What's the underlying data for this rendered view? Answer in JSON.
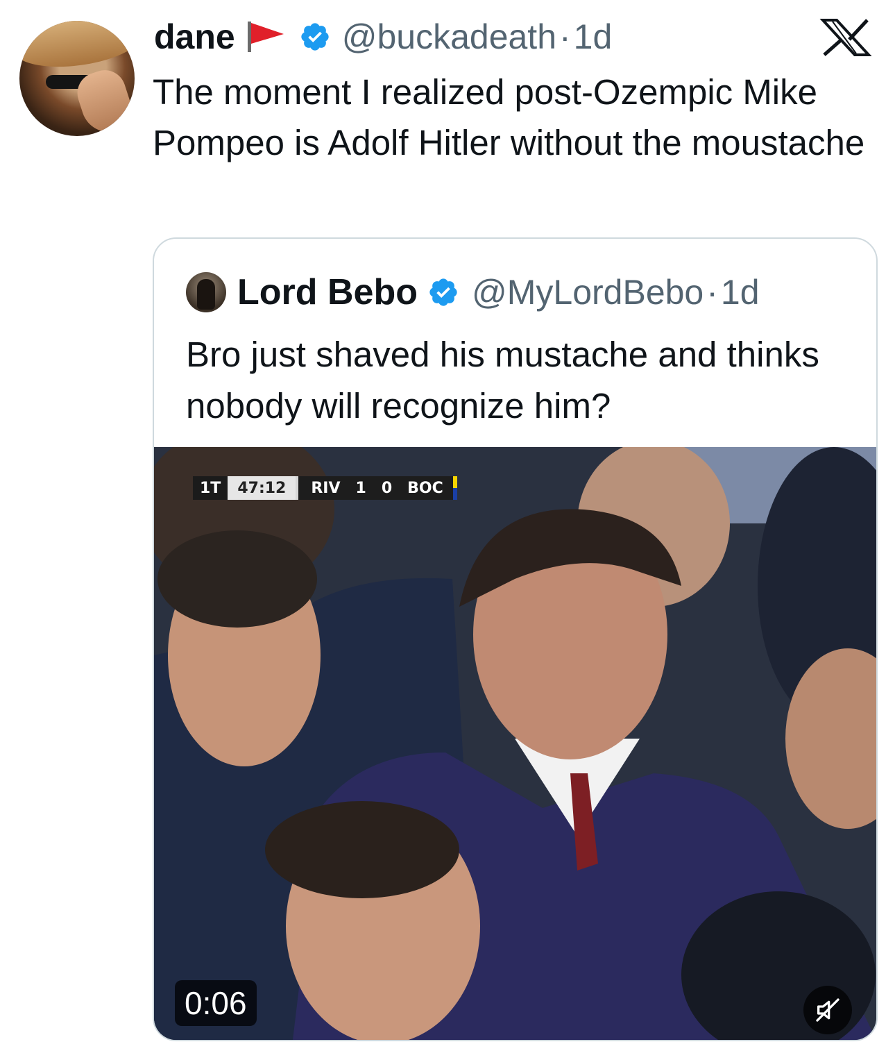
{
  "tweet": {
    "author_name": "dane",
    "author_handle": "@buckadeath",
    "separator": "·",
    "time": "1d",
    "text": "The moment I realized post-Ozempic Mike Pompeo is Adolf Hitler without the moustache"
  },
  "quoted": {
    "author_name": "Lord Bebo",
    "author_handle": "@MyLordBebo",
    "separator": "·",
    "time": "1d",
    "text": "Bro just shaved his mustache and thinks nobody will recognize him?",
    "video": {
      "duration": "0:06",
      "scoreboard": {
        "period": "1T",
        "clock": "47:12",
        "home": "RIV",
        "home_score": "1",
        "away_score": "0",
        "away": "BOC"
      }
    }
  },
  "icons": {
    "flag": "red-flag-icon",
    "verified": "verified-badge-icon",
    "brand": "x-logo-icon",
    "mute": "muted-speaker-icon"
  },
  "colors": {
    "verified_blue": "#1d9bf0",
    "secondary_text": "#536471",
    "flag_red": "#e0202a"
  }
}
